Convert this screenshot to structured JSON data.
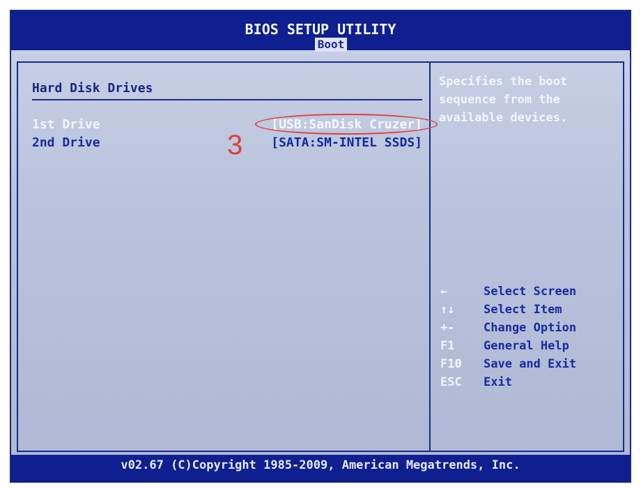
{
  "header": {
    "title": "BIOS SETUP UTILITY",
    "active_tab": "Boot"
  },
  "main": {
    "section_title": "Hard Disk Drives",
    "drives": [
      {
        "label": "1st Drive",
        "value": "[USB:SanDisk Cruzer]"
      },
      {
        "label": "2nd Drive",
        "value": "[SATA:SM-INTEL SSDS]"
      }
    ],
    "annotation": "3"
  },
  "help": {
    "description": "Specifies the boot sequence from the available devices.",
    "keys": [
      {
        "key": "←",
        "action": "Select Screen",
        "icon": "left-arrow-icon"
      },
      {
        "key": "↑↓",
        "action": "Select Item",
        "icon": "up-down-arrows-icon"
      },
      {
        "key": "+-",
        "action": "Change Option",
        "icon": "plus-minus-icon"
      },
      {
        "key": "F1",
        "action": "General Help"
      },
      {
        "key": "F10",
        "action": "Save and Exit"
      },
      {
        "key": "ESC",
        "action": "Exit"
      }
    ]
  },
  "footer": {
    "copyright": "v02.67 (C)Copyright 1985-2009, American Megatrends, Inc."
  },
  "colors": {
    "bios_blue": "#0f1f8f",
    "panel_bg": "#b9c3dc",
    "annotation_red": "#e0403c"
  }
}
